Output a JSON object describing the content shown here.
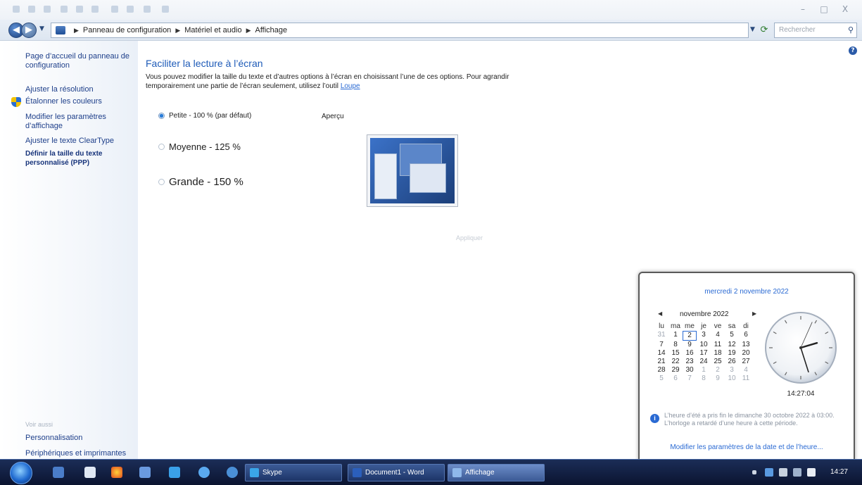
{
  "window": {
    "controls": [
      "–",
      "□",
      "X"
    ]
  },
  "addressbar": {
    "breadcrumb": [
      "Panneau de configuration",
      "Matériel et audio",
      "Affichage"
    ],
    "search_placeholder": "Rechercher"
  },
  "sidebar": {
    "home": "Page d’accueil du panneau de configuration",
    "links": [
      "Ajuster la résolution",
      "Étalonner les couleurs",
      "Modifier les paramètres d’affichage",
      "Ajuster le texte ClearType",
      "Définir la taille du texte personnalisé (PPP)"
    ],
    "see_also_label": "Voir aussi",
    "see_also": [
      "Personnalisation",
      "Périphériques et imprimantes"
    ]
  },
  "main": {
    "title": "Faciliter la lecture à l’écran",
    "description": "Vous pouvez modifier la taille du texte et d’autres options à l’écran en choisissant l’une de ces options. Pour agrandir temporairement une partie de l’écran seulement, utilisez l’outil",
    "loupe": "Loupe",
    "options": [
      {
        "label": "Petite - 100 % (par défaut)",
        "selected": true
      },
      {
        "label": "Moyenne - 125 %",
        "selected": false
      },
      {
        "label": "Grande - 150 %",
        "selected": false
      }
    ],
    "preview_label": "Aperçu",
    "apply": "Appliquer"
  },
  "flyout": {
    "long_date": "mercredi 2 novembre 2022",
    "month": "novembre 2022",
    "weekdays": [
      "lu",
      "ma",
      "me",
      "je",
      "ve",
      "sa",
      "di"
    ],
    "weeks": [
      [
        "31",
        "1",
        "2",
        "3",
        "4",
        "5",
        "6"
      ],
      [
        "7",
        "8",
        "9",
        "10",
        "11",
        "12",
        "13"
      ],
      [
        "14",
        "15",
        "16",
        "17",
        "18",
        "19",
        "20"
      ],
      [
        "21",
        "22",
        "23",
        "24",
        "25",
        "26",
        "27"
      ],
      [
        "28",
        "29",
        "30",
        "1",
        "2",
        "3",
        "4"
      ],
      [
        "5",
        "6",
        "7",
        "8",
        "9",
        "10",
        "11"
      ]
    ],
    "today": "2",
    "time": "14:27:04",
    "clock": {
      "hours": 14,
      "minutes": 27,
      "seconds": 4
    },
    "dst_note": "L’heure d’été a pris fin le dimanche 30 octobre 2022 à 03:00. L’horloge a retardé d’une heure à cette période.",
    "change_link": "Modifier les paramètres de la date et de l’heure..."
  },
  "taskbar": {
    "tasks": [
      "Skype",
      "Document1 - Word",
      "Affichage"
    ],
    "clock": "14:27"
  },
  "colors": {
    "link": "#1e3f8a",
    "title": "#1e5bb8",
    "taskbar": "#1b2d57"
  }
}
